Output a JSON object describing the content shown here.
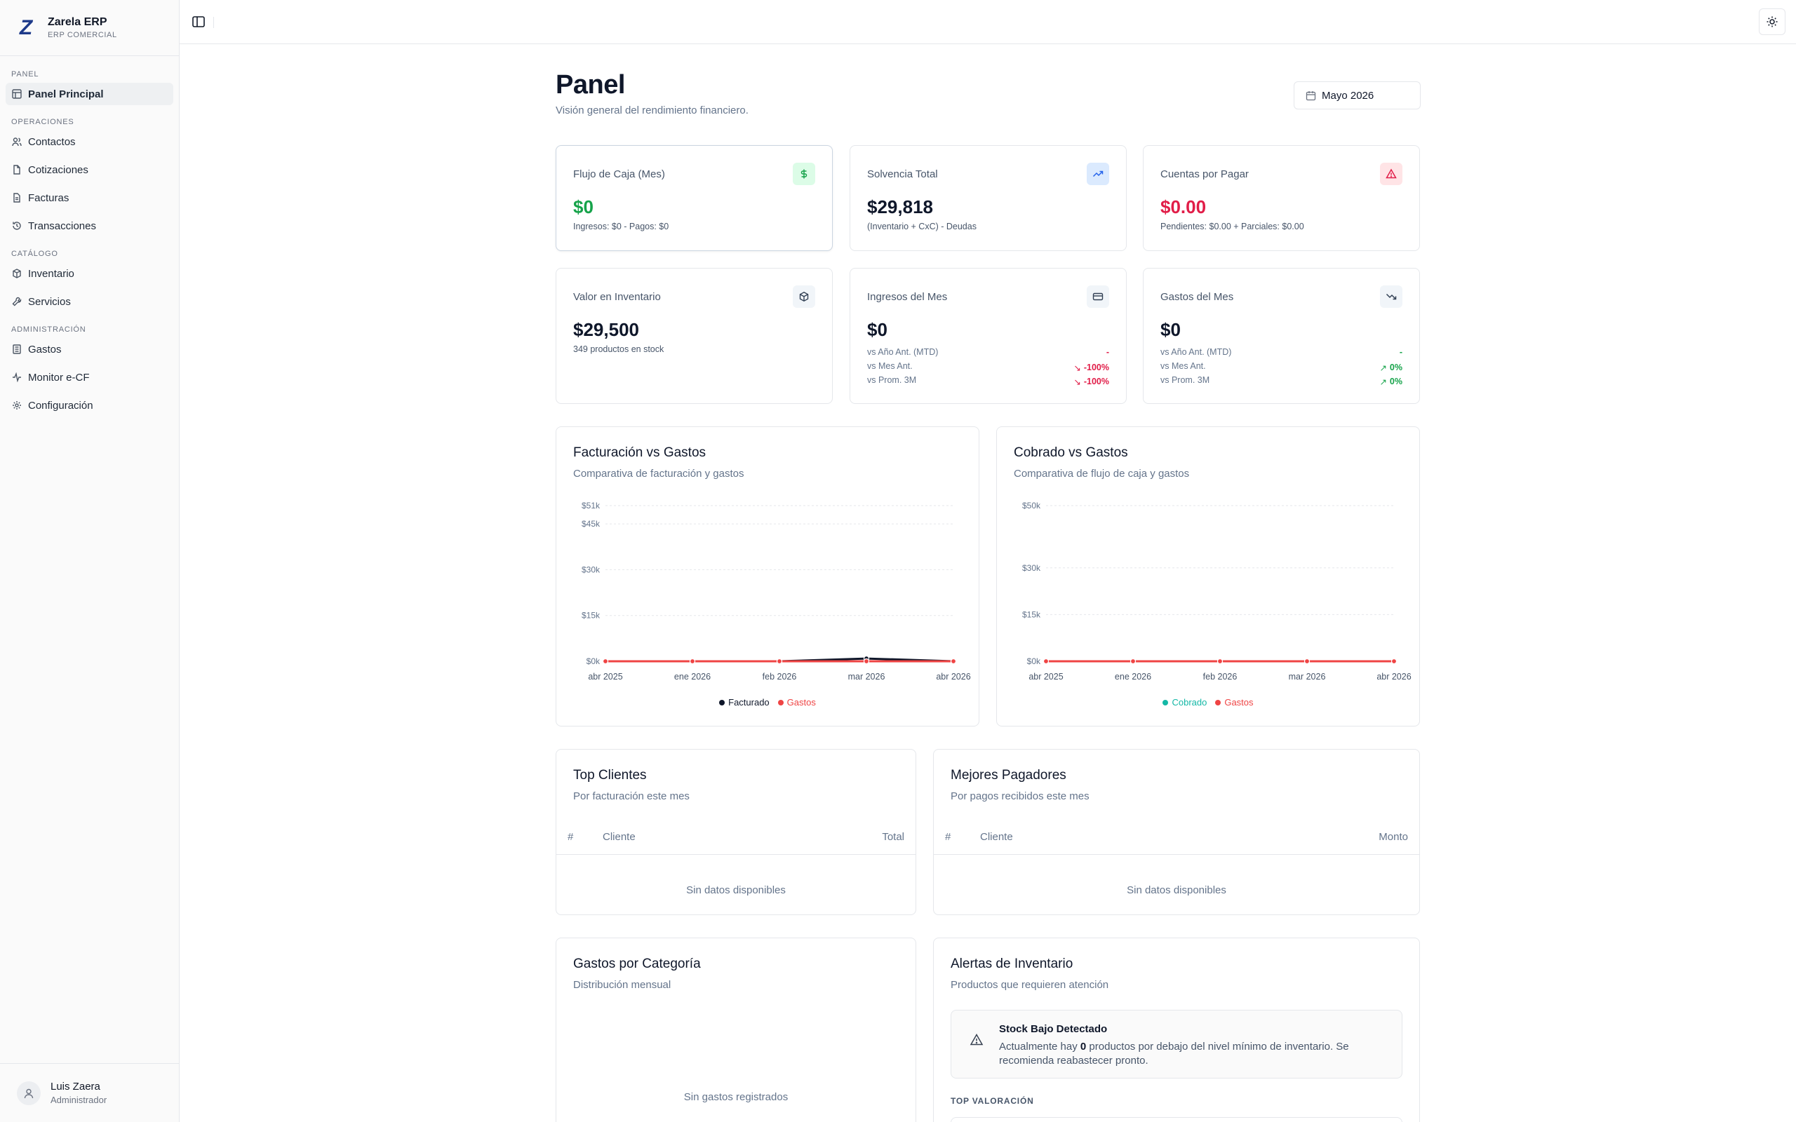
{
  "brand": {
    "logo": "Z",
    "name": "Zarela ERP",
    "subtitle": "ERP COMERCIAL"
  },
  "sidebar": {
    "sections": [
      {
        "title": "PANEL",
        "items": [
          {
            "label": "Panel Principal",
            "icon": "layout-grid-icon",
            "active": true
          }
        ]
      },
      {
        "title": "OPERACIONES",
        "items": [
          {
            "label": "Contactos",
            "icon": "users-icon"
          },
          {
            "label": "Cotizaciones",
            "icon": "file-icon"
          },
          {
            "label": "Facturas",
            "icon": "receipt-icon"
          },
          {
            "label": "Transacciones",
            "icon": "history-icon"
          }
        ]
      },
      {
        "title": "CATÁLOGO",
        "items": [
          {
            "label": "Inventario",
            "icon": "boxes-icon"
          },
          {
            "label": "Servicios",
            "icon": "wrench-icon"
          }
        ]
      },
      {
        "title": "ADMINISTRACIÓN",
        "items": [
          {
            "label": "Gastos",
            "icon": "ledger-icon"
          },
          {
            "label": "Monitor e-CF",
            "icon": "activity-icon"
          },
          {
            "label": "Configuración",
            "icon": "settings-icon"
          }
        ]
      }
    ]
  },
  "user": {
    "name": "Luis Zaera",
    "role": "Administrador"
  },
  "header": {
    "title": "Panel",
    "subtitle": "Visión general del rendimiento financiero.",
    "period": "Mayo 2026"
  },
  "kpis": {
    "cash_flow": {
      "label": "Flujo de Caja (Mes)",
      "value": "$0",
      "sub": "Ingresos: $0 - Pagos: $0",
      "color": "#16a34a"
    },
    "solvency": {
      "label": "Solvencia Total",
      "value": "$29,818",
      "sub": "(Inventario + CxC) - Deudas"
    },
    "payables": {
      "label": "Cuentas por Pagar",
      "value": "$0.00",
      "sub": "Pendientes: $0.00 + Parciales: $0.00",
      "color": "#e11d48"
    },
    "inventory": {
      "label": "Valor en Inventario",
      "value": "$29,500",
      "sub": "349 productos en stock"
    },
    "income": {
      "label": "Ingresos del Mes",
      "value": "$0",
      "rows": [
        {
          "label": "vs Año Ant. (MTD)",
          "value": "-"
        },
        {
          "label": "vs Mes Ant.",
          "value": "-100%"
        },
        {
          "label": "vs Prom. 3M",
          "value": "-100%"
        }
      ]
    },
    "expenses": {
      "label": "Gastos del Mes",
      "value": "$0",
      "rows": [
        {
          "label": "vs Año Ant. (MTD)",
          "value": "-"
        },
        {
          "label": "vs Mes Ant.",
          "value": "0%"
        },
        {
          "label": "vs Prom. 3M",
          "value": "0%"
        }
      ]
    }
  },
  "charts": {
    "billing": {
      "title": "Facturación vs Gastos",
      "desc": "Comparativa de facturación y gastos"
    },
    "collected": {
      "title": "Cobrado vs Gastos",
      "desc": "Comparativa de flujo de caja y gastos"
    }
  },
  "chart_data": [
    {
      "type": "line",
      "title": "Facturación vs Gastos",
      "categories": [
        "abr 2025",
        "ene 2026",
        "feb 2026",
        "mar 2026",
        "abr 2026"
      ],
      "y_ticks": [
        "$0k",
        "$15k",
        "$30k",
        "$45k",
        "$51k"
      ],
      "ylim": [
        0,
        51000
      ],
      "series": [
        {
          "name": "Facturado",
          "color": "#0f172a",
          "values": [
            0,
            0,
            0,
            900,
            0
          ]
        },
        {
          "name": "Gastos",
          "color": "#ef4444",
          "values": [
            0,
            0,
            0,
            0,
            0
          ]
        }
      ],
      "grid": true,
      "legend": "bottom"
    },
    {
      "type": "line",
      "title": "Cobrado vs Gastos",
      "categories": [
        "abr 2025",
        "ene 2026",
        "feb 2026",
        "mar 2026",
        "abr 2026"
      ],
      "y_ticks": [
        "$0k",
        "$15k",
        "$30k",
        "$50k"
      ],
      "ylim": [
        0,
        50000
      ],
      "series": [
        {
          "name": "Cobrado",
          "color": "#14b8a6",
          "values": [
            0,
            0,
            0,
            0,
            0
          ]
        },
        {
          "name": "Gastos",
          "color": "#ef4444",
          "values": [
            0,
            0,
            0,
            0,
            0
          ]
        }
      ],
      "grid": true,
      "legend": "bottom"
    }
  ],
  "top_clients": {
    "title": "Top Clientes",
    "desc": "Por facturación este mes",
    "cols": [
      "#",
      "Cliente",
      "Total"
    ],
    "empty": "Sin datos disponibles"
  },
  "best_payers": {
    "title": "Mejores Pagadores",
    "desc": "Por pagos recibidos este mes",
    "cols": [
      "#",
      "Cliente",
      "Monto"
    ],
    "empty": "Sin datos disponibles"
  },
  "expenses_by_category": {
    "title": "Gastos por Categoría",
    "desc": "Distribución mensual",
    "empty": "Sin gastos registrados"
  },
  "inventory_alerts": {
    "title": "Alertas de Inventario",
    "desc": "Productos que requieren atención",
    "alert_title": "Stock Bajo Detectado",
    "alert_pre": "Actualmente hay ",
    "alert_count": "0",
    "alert_post": " productos por debajo del nivel mínimo de inventario. Se recomienda reabastecer pronto.",
    "section": "TOP VALORACIÓN"
  },
  "colors": {
    "positive": "#16a34a",
    "negative": "#e11d48",
    "accent_blue": "#3b82f6"
  }
}
